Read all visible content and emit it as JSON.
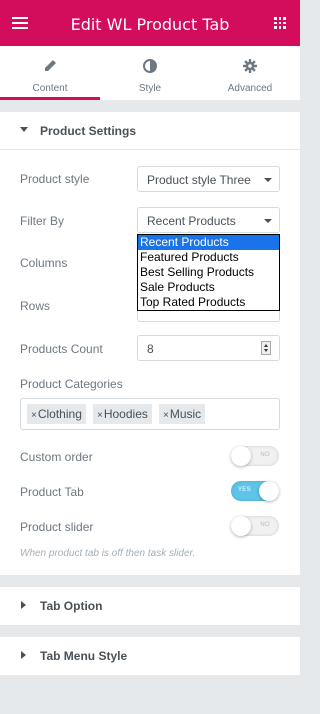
{
  "header": {
    "title": "Edit WL Product Tab"
  },
  "tabs": [
    {
      "label": "Content",
      "active": true
    },
    {
      "label": "Style",
      "active": false
    },
    {
      "label": "Advanced",
      "active": false
    }
  ],
  "section": {
    "title": "Product Settings"
  },
  "fields": {
    "product_style": {
      "label": "Product style",
      "value": "Product style Three"
    },
    "filter_by": {
      "label": "Filter By",
      "value": "Recent Products",
      "options": [
        "Recent Products",
        "Featured Products",
        "Best Selling Products",
        "Sale Products",
        "Top Rated Products"
      ],
      "selected_index": 0
    },
    "columns": {
      "label": "Columns"
    },
    "rows": {
      "label": "Rows"
    },
    "products_count": {
      "label": "Products Count",
      "value": "8"
    },
    "product_categories": {
      "label": "Product Categories",
      "tags": [
        "Clothing",
        "Hoodies",
        "Music"
      ]
    },
    "custom_order": {
      "label": "Custom order",
      "state": "NO"
    },
    "product_tab": {
      "label": "Product Tab",
      "state": "YES"
    },
    "product_slider": {
      "label": "Product slider",
      "state": "NO"
    }
  },
  "note": "When product tab is off then task slider.",
  "collapsed_sections": [
    "Tab Option",
    "Tab Menu Style"
  ],
  "colors": {
    "brand": "#d30c5c",
    "switch_on": "#5ec5e8",
    "selected_option": "#1a73e8"
  },
  "icons": [
    "hamburger-icon",
    "apps-grid-icon",
    "pencil-icon",
    "contrast-icon",
    "gear-icon"
  ]
}
